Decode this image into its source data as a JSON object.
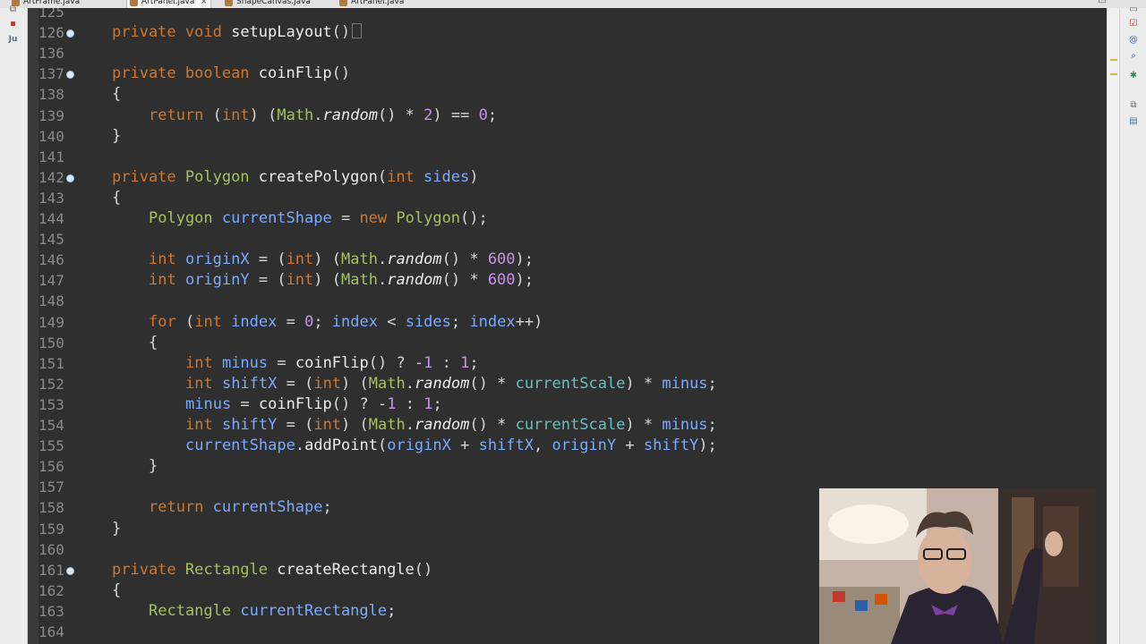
{
  "tabs": [
    {
      "label": "ArtFrame.java",
      "active": false
    },
    {
      "label": "ArtPanel.java",
      "active": true
    },
    {
      "label": "ShapeCanvas.java",
      "active": false
    },
    {
      "label": "ArtPanel.java",
      "active": false
    }
  ],
  "editor": {
    "lines": [
      {
        "n": "125",
        "fold": false,
        "indent": 0,
        "tokens": []
      },
      {
        "n": "126",
        "fold": true,
        "indent": 1,
        "tokens": [
          [
            "kw",
            "private "
          ],
          [
            "kw",
            "void "
          ],
          [
            "fn",
            "setupLayout"
          ],
          [
            "op",
            "()"
          ]
        ],
        "folded": true
      },
      {
        "n": "136",
        "fold": false,
        "indent": 0,
        "tokens": []
      },
      {
        "n": "137",
        "fold": true,
        "indent": 1,
        "tokens": [
          [
            "kw",
            "private "
          ],
          [
            "kw",
            "boolean "
          ],
          [
            "fn",
            "coinFlip"
          ],
          [
            "op",
            "()"
          ]
        ]
      },
      {
        "n": "138",
        "fold": false,
        "indent": 1,
        "tokens": [
          [
            "op",
            "{"
          ]
        ]
      },
      {
        "n": "139",
        "fold": false,
        "indent": 2,
        "tokens": [
          [
            "kw",
            "return "
          ],
          [
            "op",
            "("
          ],
          [
            "kw",
            "int"
          ],
          [
            "op",
            ") ("
          ],
          [
            "ty",
            "Math"
          ],
          [
            "op",
            "."
          ],
          [
            "it",
            "random"
          ],
          [
            "op",
            "() * "
          ],
          [
            "num",
            "2"
          ],
          [
            "op",
            ") == "
          ],
          [
            "num",
            "0"
          ],
          [
            "op",
            ";"
          ]
        ]
      },
      {
        "n": "140",
        "fold": false,
        "indent": 1,
        "tokens": [
          [
            "op",
            "}"
          ]
        ]
      },
      {
        "n": "141",
        "fold": false,
        "indent": 0,
        "tokens": []
      },
      {
        "n": "142",
        "fold": true,
        "indent": 1,
        "tokens": [
          [
            "kw",
            "private "
          ],
          [
            "ty",
            "Polygon "
          ],
          [
            "fn",
            "createPolygon"
          ],
          [
            "op",
            "("
          ],
          [
            "kw",
            "int "
          ],
          [
            "par",
            "sides"
          ],
          [
            "op",
            ")"
          ]
        ]
      },
      {
        "n": "143",
        "fold": false,
        "indent": 1,
        "tokens": [
          [
            "op",
            "{"
          ]
        ]
      },
      {
        "n": "144",
        "fold": false,
        "indent": 2,
        "tokens": [
          [
            "ty",
            "Polygon "
          ],
          [
            "var",
            "currentShape"
          ],
          [
            "op",
            " = "
          ],
          [
            "kw",
            "new "
          ],
          [
            "ty",
            "Polygon"
          ],
          [
            "op",
            "();"
          ]
        ]
      },
      {
        "n": "145",
        "fold": false,
        "indent": 0,
        "tokens": []
      },
      {
        "n": "146",
        "fold": false,
        "indent": 2,
        "tokens": [
          [
            "kw",
            "int "
          ],
          [
            "var",
            "originX"
          ],
          [
            "op",
            " = ("
          ],
          [
            "kw",
            "int"
          ],
          [
            "op",
            ") ("
          ],
          [
            "ty",
            "Math"
          ],
          [
            "op",
            "."
          ],
          [
            "it",
            "random"
          ],
          [
            "op",
            "() * "
          ],
          [
            "num",
            "600"
          ],
          [
            "op",
            ");"
          ]
        ]
      },
      {
        "n": "147",
        "fold": false,
        "indent": 2,
        "tokens": [
          [
            "kw",
            "int "
          ],
          [
            "var",
            "originY"
          ],
          [
            "op",
            " = ("
          ],
          [
            "kw",
            "int"
          ],
          [
            "op",
            ") ("
          ],
          [
            "ty",
            "Math"
          ],
          [
            "op",
            "."
          ],
          [
            "it",
            "random"
          ],
          [
            "op",
            "() * "
          ],
          [
            "num",
            "600"
          ],
          [
            "op",
            ");"
          ]
        ]
      },
      {
        "n": "148",
        "fold": false,
        "indent": 0,
        "tokens": []
      },
      {
        "n": "149",
        "fold": false,
        "indent": 2,
        "tokens": [
          [
            "kw",
            "for "
          ],
          [
            "op",
            "("
          ],
          [
            "kw",
            "int "
          ],
          [
            "var",
            "index"
          ],
          [
            "op",
            " = "
          ],
          [
            "num",
            "0"
          ],
          [
            "op",
            "; "
          ],
          [
            "var",
            "index"
          ],
          [
            "op",
            " < "
          ],
          [
            "par",
            "sides"
          ],
          [
            "op",
            "; "
          ],
          [
            "var",
            "index"
          ],
          [
            "op",
            "++)"
          ]
        ]
      },
      {
        "n": "150",
        "fold": false,
        "indent": 2,
        "tokens": [
          [
            "op",
            "{"
          ]
        ]
      },
      {
        "n": "151",
        "fold": false,
        "indent": 3,
        "tokens": [
          [
            "kw",
            "int "
          ],
          [
            "var",
            "minus"
          ],
          [
            "op",
            " = "
          ],
          [
            "fn",
            "coinFlip"
          ],
          [
            "op",
            "() ? -"
          ],
          [
            "num",
            "1"
          ],
          [
            "op",
            " : "
          ],
          [
            "num",
            "1"
          ],
          [
            "op",
            ";"
          ]
        ]
      },
      {
        "n": "152",
        "fold": false,
        "indent": 3,
        "tokens": [
          [
            "kw",
            "int "
          ],
          [
            "var",
            "shiftX"
          ],
          [
            "op",
            " = ("
          ],
          [
            "kw",
            "int"
          ],
          [
            "op",
            ") ("
          ],
          [
            "ty",
            "Math"
          ],
          [
            "op",
            "."
          ],
          [
            "it",
            "random"
          ],
          [
            "op",
            "() * "
          ],
          [
            "fld",
            "currentScale"
          ],
          [
            "op",
            ") * "
          ],
          [
            "var",
            "minus"
          ],
          [
            "op",
            ";"
          ]
        ]
      },
      {
        "n": "153",
        "fold": false,
        "indent": 3,
        "tokens": [
          [
            "var",
            "minus"
          ],
          [
            "op",
            " = "
          ],
          [
            "fn",
            "coinFlip"
          ],
          [
            "op",
            "() ? -"
          ],
          [
            "num",
            "1"
          ],
          [
            "op",
            " : "
          ],
          [
            "num",
            "1"
          ],
          [
            "op",
            ";"
          ]
        ]
      },
      {
        "n": "154",
        "fold": false,
        "indent": 3,
        "tokens": [
          [
            "kw",
            "int "
          ],
          [
            "var",
            "shiftY"
          ],
          [
            "op",
            " = ("
          ],
          [
            "kw",
            "int"
          ],
          [
            "op",
            ") ("
          ],
          [
            "ty",
            "Math"
          ],
          [
            "op",
            "."
          ],
          [
            "it",
            "random"
          ],
          [
            "op",
            "() * "
          ],
          [
            "fld",
            "currentScale"
          ],
          [
            "op",
            ") * "
          ],
          [
            "var",
            "minus"
          ],
          [
            "op",
            ";"
          ]
        ]
      },
      {
        "n": "155",
        "fold": false,
        "indent": 3,
        "tokens": [
          [
            "var",
            "currentShape"
          ],
          [
            "op",
            "."
          ],
          [
            "fn",
            "addPoint"
          ],
          [
            "op",
            "("
          ],
          [
            "var",
            "originX"
          ],
          [
            "op",
            " + "
          ],
          [
            "var",
            "shiftX"
          ],
          [
            "op",
            ", "
          ],
          [
            "var",
            "originY"
          ],
          [
            "op",
            " + "
          ],
          [
            "var",
            "shiftY"
          ],
          [
            "op",
            ");"
          ]
        ]
      },
      {
        "n": "156",
        "fold": false,
        "indent": 2,
        "tokens": [
          [
            "op",
            "}"
          ]
        ]
      },
      {
        "n": "157",
        "fold": false,
        "indent": 0,
        "tokens": []
      },
      {
        "n": "158",
        "fold": false,
        "indent": 2,
        "tokens": [
          [
            "kw",
            "return "
          ],
          [
            "var",
            "currentShape"
          ],
          [
            "op",
            ";"
          ]
        ]
      },
      {
        "n": "159",
        "fold": false,
        "indent": 1,
        "tokens": [
          [
            "op",
            "}"
          ]
        ]
      },
      {
        "n": "160",
        "fold": false,
        "indent": 0,
        "tokens": []
      },
      {
        "n": "161",
        "fold": true,
        "indent": 1,
        "tokens": [
          [
            "kw",
            "private "
          ],
          [
            "ty",
            "Rectangle "
          ],
          [
            "fn",
            "createRectangle"
          ],
          [
            "op",
            "()"
          ]
        ]
      },
      {
        "n": "162",
        "fold": false,
        "indent": 1,
        "tokens": [
          [
            "op",
            "{"
          ]
        ]
      },
      {
        "n": "163",
        "fold": false,
        "indent": 2,
        "tokens": [
          [
            "ty",
            "Rectangle "
          ],
          [
            "var",
            "currentRectangle"
          ],
          [
            "op",
            ";"
          ]
        ]
      },
      {
        "n": "164",
        "fold": false,
        "indent": 0,
        "tokens": []
      }
    ]
  },
  "colors": {
    "editor_bg": "#2f2f2f",
    "keyword": "#cc7832",
    "type": "#a5c25c",
    "variable": "#79abff",
    "number": "#c792ea"
  },
  "icons": {
    "left": [
      "restore-icon",
      "package-icon",
      "junit-icon"
    ],
    "right": [
      "minimize-icon",
      "task-icon",
      "at-icon",
      "search-icon",
      "debug-icon",
      "restore-icon",
      "console-icon"
    ]
  }
}
